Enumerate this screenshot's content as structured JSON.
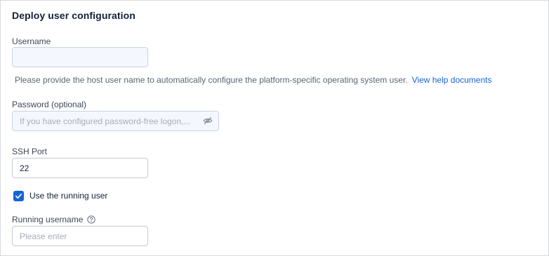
{
  "section": {
    "title": "Deploy user configuration"
  },
  "username": {
    "label": "Username",
    "value": "",
    "placeholder": "",
    "hint": "Please provide the host user name to automatically configure the platform-specific operating system user.",
    "help_link": "View help documents"
  },
  "password": {
    "label": "Password (optional)",
    "value": "",
    "placeholder": "If you have configured password-free logon,...",
    "visibility_icon": "eye-slash-icon"
  },
  "ssh_port": {
    "label": "SSH Port",
    "value": "22"
  },
  "running_user": {
    "checkbox_label": "Use the running user",
    "checked": true
  },
  "running_username": {
    "label": "Running username",
    "help_icon": "question-circle-icon",
    "value": "",
    "placeholder": "Please enter"
  },
  "colors": {
    "accent": "#1764d6",
    "border": "#c4cad4",
    "text": "#132039"
  }
}
